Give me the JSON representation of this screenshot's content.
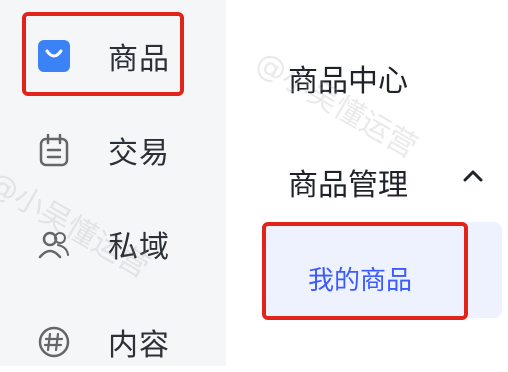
{
  "left_nav": {
    "items": [
      {
        "label": "商品",
        "icon": "goods-icon"
      },
      {
        "label": "交易",
        "icon": "trade-icon"
      },
      {
        "label": "私域",
        "icon": "private-domain-icon"
      },
      {
        "label": "内容",
        "icon": "content-icon"
      }
    ]
  },
  "submenu": {
    "item1": "商品中心",
    "group": "商品管理",
    "group_chevron": "chevron-up-icon",
    "active_item": "我的商品"
  },
  "colors": {
    "accent_blue": "#3b82f6",
    "highlight_red": "#e2231a"
  },
  "watermark": {
    "text1": "@小吴懂运营",
    "text2": "@小吴懂运营"
  }
}
